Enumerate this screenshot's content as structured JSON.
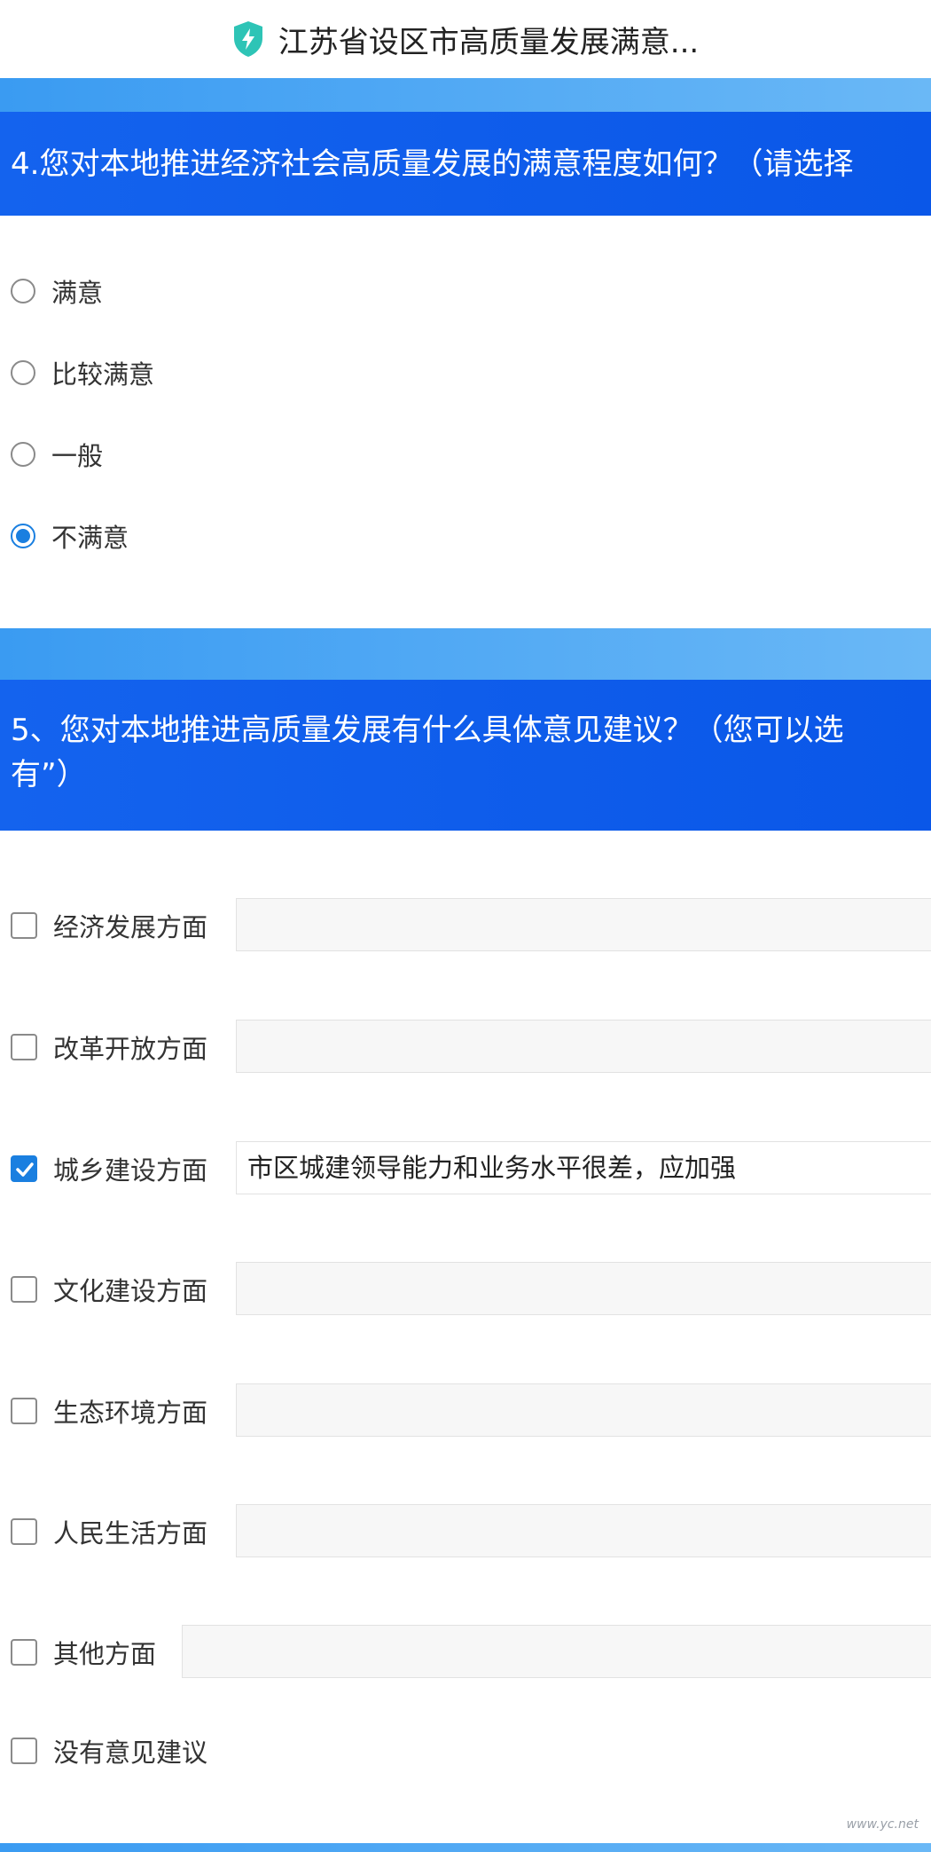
{
  "header": {
    "title": "江苏省设区市高质量发展满意...",
    "icon": "shield-bolt-icon",
    "accent": "#2ec4b6"
  },
  "q4": {
    "title": "4.您对本地推进经济社会高质量发展的满意程度如何？（请选择",
    "options": [
      {
        "label": "满意",
        "checked": false
      },
      {
        "label": "比较满意",
        "checked": false
      },
      {
        "label": "一般",
        "checked": false
      },
      {
        "label": "不满意",
        "checked": true
      }
    ]
  },
  "q5": {
    "title_line1": "5、您对本地推进高质量发展有什么具体意见建议？（您可以选",
    "title_line2": "有”）",
    "items": [
      {
        "label": "经济发展方面",
        "checked": false,
        "value": ""
      },
      {
        "label": "改革开放方面",
        "checked": false,
        "value": ""
      },
      {
        "label": "城乡建设方面",
        "checked": true,
        "value": "市区城建领导能力和业务水平很差，应加强"
      },
      {
        "label": "文化建设方面",
        "checked": false,
        "value": ""
      },
      {
        "label": "生态环境方面",
        "checked": false,
        "value": ""
      },
      {
        "label": "人民生活方面",
        "checked": false,
        "value": ""
      },
      {
        "label": "其他方面",
        "checked": false,
        "value": ""
      },
      {
        "label": "没有意见建议",
        "checked": false
      }
    ]
  },
  "colors": {
    "question_header": "#0a57e8",
    "band": "#4aa6f4",
    "checked": "#1a7fe0"
  },
  "watermark": "www.yc.net"
}
